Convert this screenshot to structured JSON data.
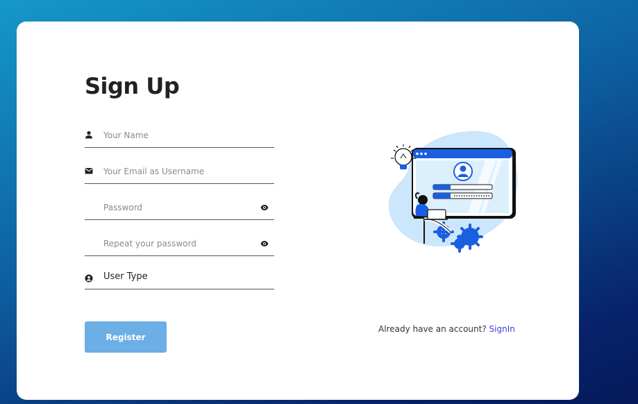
{
  "form": {
    "title": "Sign Up",
    "fields": [
      {
        "icon": "person-icon",
        "placeholder": "Your Name"
      },
      {
        "icon": "envelope-icon",
        "placeholder": "Your Email as Username"
      },
      {
        "icon": "",
        "placeholder": "Password",
        "toggle_icon": "eye-icon"
      },
      {
        "icon": "",
        "placeholder": "Repeat your password",
        "toggle_icon": "eye-icon"
      },
      {
        "icon": "user-circle-icon",
        "selected_value": "User Type"
      }
    ],
    "register_label": "Register"
  },
  "signin": {
    "prompt": "Already have an account?",
    "link_label": "SignIn"
  },
  "colors": {
    "bg_gradient_start": "#1598c9",
    "bg_gradient_end": "#061a5a",
    "card": "#ffffff",
    "register_button": "#6caee6",
    "link": "#3b3ee0",
    "illustration_blue": "#1a5fe0",
    "illustration_light": "#cce6fb"
  },
  "illustration": {
    "subject": "person with laptop beside browser login window, gears and lightbulb"
  }
}
